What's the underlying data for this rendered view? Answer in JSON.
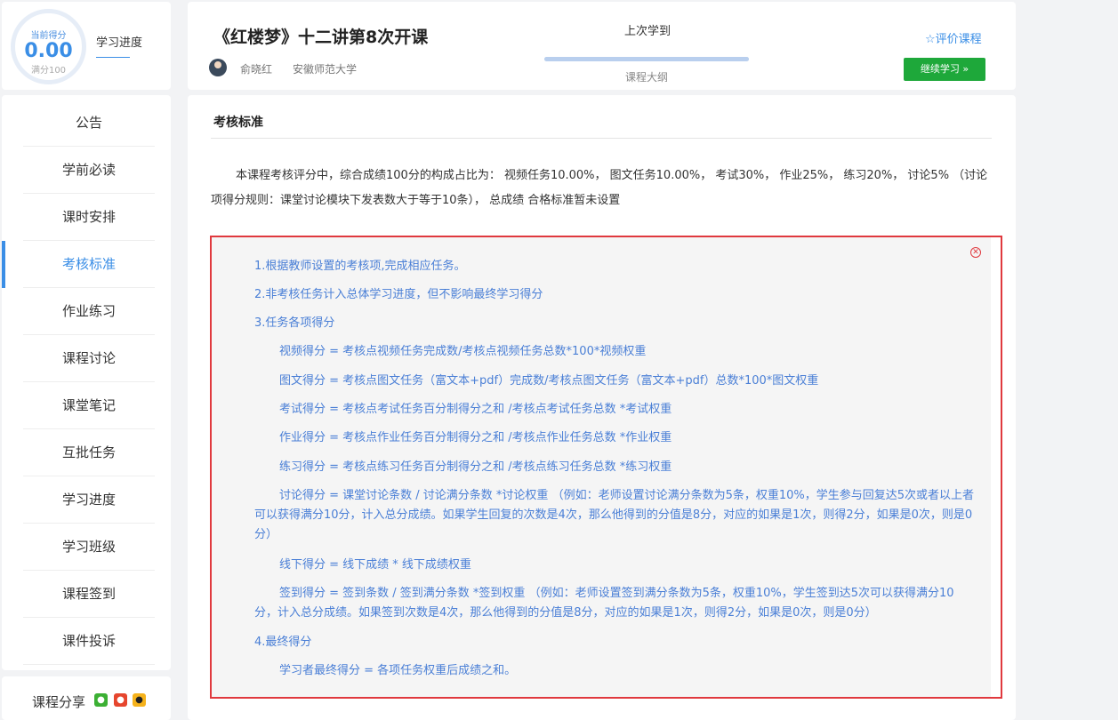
{
  "score": {
    "label": "当前得分",
    "value": "0.00",
    "max_label": "满分100",
    "progress_link": "学习进度"
  },
  "sidebar": {
    "items": [
      {
        "label": "公告"
      },
      {
        "label": "学前必读"
      },
      {
        "label": "课时安排"
      },
      {
        "label": "考核标准"
      },
      {
        "label": "作业练习"
      },
      {
        "label": "课程讨论"
      },
      {
        "label": "课堂笔记"
      },
      {
        "label": "互批任务"
      },
      {
        "label": "学习进度"
      },
      {
        "label": "学习班级"
      },
      {
        "label": "课程签到"
      },
      {
        "label": "课件投诉"
      }
    ],
    "active": "考核标准"
  },
  "share": {
    "label": "课程分享",
    "icons": [
      "wechat-icon",
      "weibo-icon",
      "qq-icon"
    ],
    "colors": {
      "wechat": "#3cb034",
      "weibo": "#e6462e",
      "qq": "#f5b21c"
    }
  },
  "header": {
    "title": "《红楼梦》十二讲第8次开课",
    "teacher": "俞晓红",
    "school": "安徽师范大学",
    "last_study_label": "上次学到",
    "progress": 1.0,
    "outline_label": "课程大纲",
    "rate_label": "☆评价课程",
    "continue_label": "继续学习 »"
  },
  "content": {
    "section_title": "考核标准",
    "summary": "本课程考核评分中，综合成绩100分的构成占比为： 视频任务10.00%， 图文任务10.00%， 考试30%， 作业25%， 练习20%， 讨论5% （讨论项得分规则：课堂讨论模块下发表数大于等于10条）， 总成绩 合格标准暂未设置",
    "rules": [
      "1.根据教师设置的考核项,完成相应任务。",
      "2.非考核任务计入总体学习进度，但不影响最终学习得分",
      "3.任务各项得分",
      "视频得分 = 考核点视频任务完成数/考核点视频任务总数*100*视频权重",
      "图文得分 = 考核点图文任务（富文本+pdf）完成数/考核点图文任务（富文本+pdf）总数*100*图文权重",
      "考试得分 = 考核点考试任务百分制得分之和 /考核点考试任务总数 *考试权重",
      "作业得分 = 考核点作业任务百分制得分之和 /考核点作业任务总数 *作业权重",
      "练习得分 = 考核点练习任务百分制得分之和 /考核点练习任务总数 *练习权重",
      "讨论得分 = 课堂讨论条数 / 讨论满分条数 *讨论权重 （例如：老师设置讨论满分条数为5条，权重10%，学生参与回复达5次或者以上者可以获得满分10分，计入总分成绩。如果学生回复的次数是4次，那么他得到的分值是8分，对应的如果是1次，则得2分，如果是0次，则是0分）",
      "线下得分 = 线下成绩 * 线下成绩权重",
      "签到得分 = 签到条数 / 签到满分条数 *签到权重 （例如：老师设置签到满分条数为5条，权重10%，学生签到达5次可以获得满分10分，计入总分成绩。如果签到次数是4次，那么他得到的分值是8分，对应的如果是1次，则得2分，如果是0次，则是0分）",
      "4.最终得分",
      "学习者最终得分 = 各项任务权重后成绩之和。"
    ],
    "close_symbol": "✕"
  },
  "colors": {
    "accent": "#3a8ee6",
    "continue_button": "#1ea83a",
    "rules_border": "#e0393e",
    "rules_text": "#4a7fd6"
  }
}
